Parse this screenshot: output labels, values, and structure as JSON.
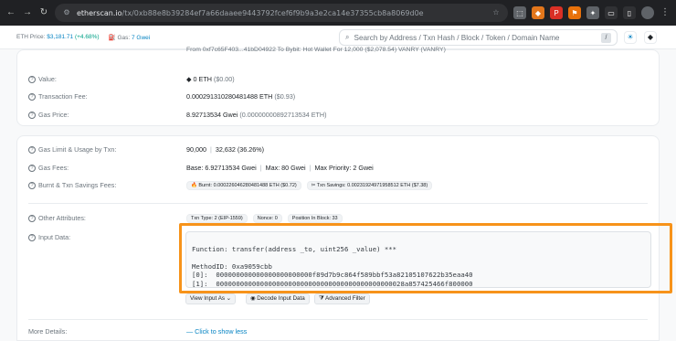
{
  "browser": {
    "url_domain": "etherscan.io",
    "url_path": "/tx/0xb88e8b39284ef7a66daaee9443792fcef6f9b9a3e2ca14e37355cb8a8069d0e"
  },
  "topbar": {
    "eth_price_label": "ETH Price:",
    "eth_price_value": "$3,181.71",
    "eth_price_change": "(+4.68%)",
    "gas_label": "Gas:",
    "gas_value": "7 Gwei",
    "search_placeholder": "Search by Address / Txn Hash / Block / Token / Domain Name",
    "search_shortcut": "/"
  },
  "partial_row": {
    "text": "From 0xf7c65F403...41bD04922 To Bybit: Hot Wallet For 12,000 ($2,078.54) VANRY (VANRY)"
  },
  "value": {
    "label": "Value:",
    "amount": "0 ETH",
    "usd": "($0.00)"
  },
  "fee": {
    "label": "Transaction Fee:",
    "amount": "0.000291310280481488 ETH",
    "usd": "($0.93)"
  },
  "gas_price": {
    "label": "Gas Price:",
    "amount": "8.92713534 Gwei",
    "eth": "(0.00000000892713534 ETH)"
  },
  "gas_limit": {
    "label": "Gas Limit & Usage by Txn:",
    "limit": "90,000",
    "used": "32,632 (36.26%)"
  },
  "gas_fees": {
    "label": "Gas Fees:",
    "base": "Base: 6.92713534 Gwei",
    "max": "Max: 80 Gwei",
    "priority": "Max Priority: 2 Gwei"
  },
  "burnt": {
    "label": "Burnt & Txn Savings Fees:",
    "burnt": "Burnt: 0.000226046280481488 ETH ($0.72)",
    "savings": "Txn Savings: 0.00231924971958512 ETH ($7.38)"
  },
  "other": {
    "label": "Other Attributes:",
    "txn_type": "Txn Type: 2 (EIP-1559)",
    "nonce": "Nonce: 0",
    "position": "Position In Block: 33"
  },
  "input": {
    "label": "Input Data:",
    "lines": [
      "Function: transfer(address _to, uint256 _value) ***",
      "",
      "MethodID: 0xa9059cbb",
      "[0]:  000000000000000000000000f89d7b9c864f589bbf53a82105107622b35eaa40",
      "[1]:  00000000000000000000000000000000000000000000028a857425466f800000"
    ],
    "view_as_button": "View Input As",
    "decode_button": "Decode Input Data",
    "advanced_button": "Advanced Filter"
  },
  "more": {
    "label": "More Details:",
    "link": "— Click to show less"
  }
}
